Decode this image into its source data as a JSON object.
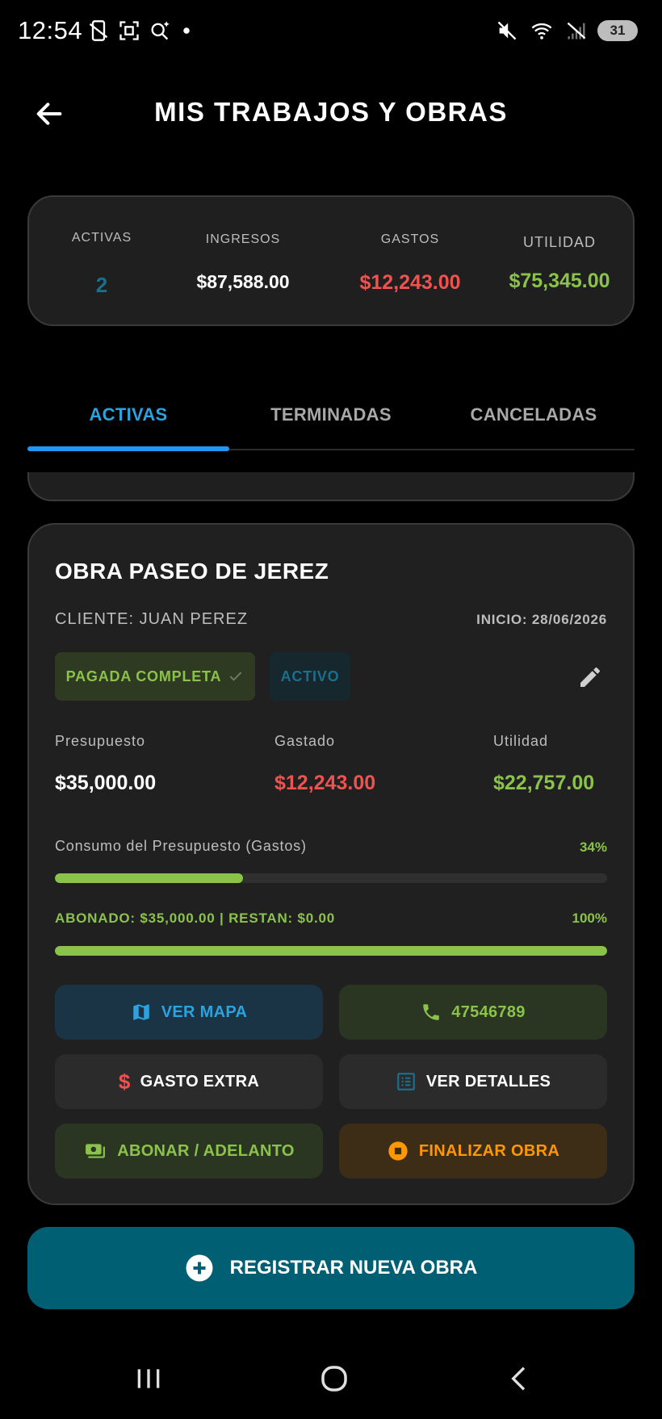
{
  "status_bar": {
    "time": "12:54",
    "battery": "31",
    "left_icons": [
      "phone-off-icon",
      "screenshot-icon",
      "search-spark-icon",
      "dot-icon"
    ],
    "right_icons": [
      "mute-icon",
      "wifi-icon",
      "signal-off-icon"
    ]
  },
  "header": {
    "title": "MIS TRABAJOS Y OBRAS",
    "back_icon": "arrow-left-icon"
  },
  "summary": {
    "activas_label": "ACTIVAS",
    "activas_value": "2",
    "ingresos_label": "INGRESOS",
    "ingresos_value": "$87,588.00",
    "gastos_label": "GASTOS",
    "gastos_value": "$12,243.00",
    "utilidad_label": "UTILIDAD",
    "utilidad_value": "$75,345.00"
  },
  "tabs": {
    "activas": "ACTIVAS",
    "terminadas": "TERMINADAS",
    "canceladas": "CANCELADAS",
    "selected": "ACTIVAS"
  },
  "project": {
    "title": "OBRA PASEO DE JEREZ",
    "client": "CLIENTE: JUAN PEREZ",
    "start": "INICIO: 28/06/2026",
    "badge_paid": "PAGADA COMPLETA",
    "badge_status": "ACTIVO",
    "presupuesto_label": "Presupuesto",
    "presupuesto_value": "$35,000.00",
    "gastado_label": "Gastado",
    "gastado_value": "$12,243.00",
    "utilidad_label": "Utilidad",
    "utilidad_value": "$22,757.00",
    "consumo_label": "Consumo del Presupuesto (Gastos)",
    "consumo_pct": "34%",
    "consumo_fraction": 0.34,
    "abonado_label": "ABONADO: $35,000.00 | RESTAN: $0.00",
    "abonado_pct": "100%",
    "abonado_fraction": 1.0,
    "buttons": {
      "mapa": "VER MAPA",
      "phone": "47546789",
      "gasto": "GASTO EXTRA",
      "detalles": "VER DETALLES",
      "abonar": "ABONAR / ADELANTO",
      "finalizar": "FINALIZAR OBRA"
    }
  },
  "register_button": "REGISTRAR NUEVA OBRA",
  "colors": {
    "accent_blue": "#2196f3",
    "green": "#8bc34a",
    "red": "#ef5350",
    "orange": "#ff9800",
    "teal": "#005f73"
  }
}
